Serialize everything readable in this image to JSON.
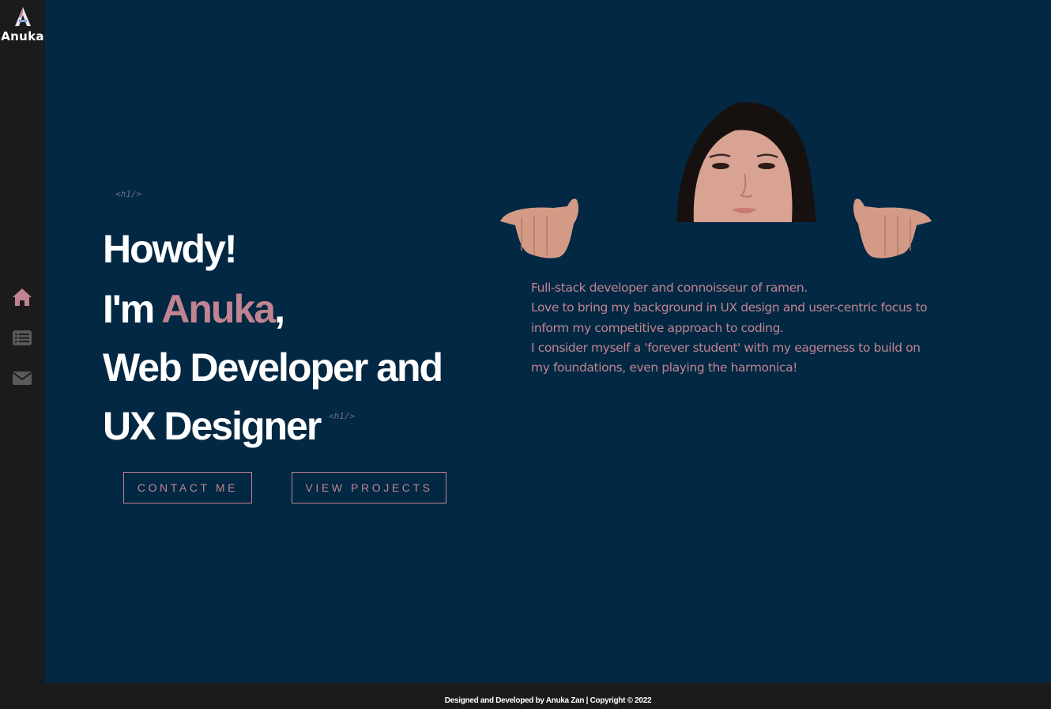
{
  "brand": {
    "name": "Anuka",
    "initial": "A"
  },
  "sidebar": {
    "items": [
      {
        "name": "home",
        "icon": "home-icon",
        "color": "#c08490"
      },
      {
        "name": "projects",
        "icon": "list-icon",
        "color": "#5a5a5a"
      },
      {
        "name": "contact",
        "icon": "envelope-icon",
        "color": "#5a5a5a"
      }
    ]
  },
  "hero": {
    "open_tag": "<h1/>",
    "close_tag": "<h1/>",
    "line1": "Howdy!",
    "line2_prefix": "I'm ",
    "line2_name": "Anuka",
    "line2_suffix": ",",
    "line3": "Web Developer and",
    "line4": "UX Designer"
  },
  "buttons": {
    "contact_label": "CONTACT ME",
    "projects_label": "VIEW PROJECTS"
  },
  "bio": {
    "line1": "Full-stack developer and connoisseur of ramen.",
    "line2": "Love to bring my background in UX design and user-centric focus to inform my competitive approach to coding.",
    "line3": "I consider myself a 'forever student' with my eagerness to build on my foundations, even playing the harmonica!"
  },
  "footer": {
    "text": "Designed and Developed by Anuka Zan | Copyright © 2022"
  },
  "colors": {
    "background": "#022843",
    "sidebar": "#1b1b1b",
    "accent": "#c08490",
    "text": "#ffffff"
  }
}
